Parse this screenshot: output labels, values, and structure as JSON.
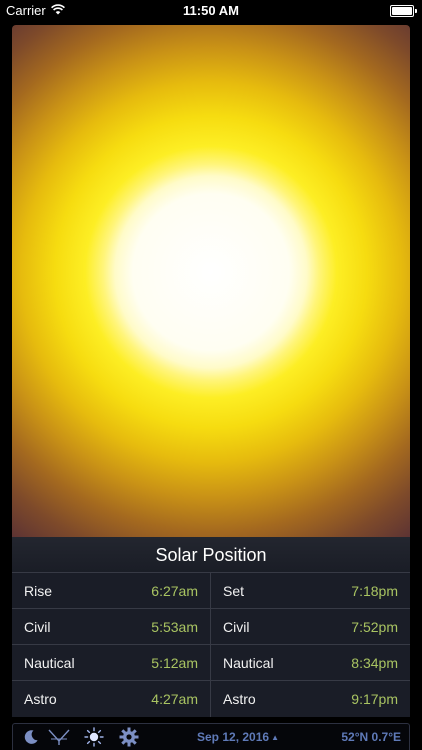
{
  "status_bar": {
    "carrier": "Carrier",
    "time": "11:50 AM"
  },
  "solar": {
    "title": "Solar Position",
    "left": [
      {
        "label": "Rise",
        "value": "6:27am"
      },
      {
        "label": "Civil",
        "value": "5:53am"
      },
      {
        "label": "Nautical",
        "value": "5:12am"
      },
      {
        "label": "Astro",
        "value": "4:27am"
      }
    ],
    "right": [
      {
        "label": "Set",
        "value": "7:18pm"
      },
      {
        "label": "Civil",
        "value": "7:52pm"
      },
      {
        "label": "Nautical",
        "value": "8:34pm"
      },
      {
        "label": "Astro",
        "value": "9:17pm"
      }
    ]
  },
  "toolbar": {
    "icons": [
      "moon-icon",
      "telescope-icon",
      "sun-icon",
      "gear-icon"
    ],
    "date": "Sep 12, 2016",
    "latitude": "52°N",
    "longitude": "0.7°E"
  },
  "colors": {
    "value_green": "#a9c462",
    "toolbar_blue": "#5f7ab8",
    "panel_bg": "#1a1d27"
  }
}
